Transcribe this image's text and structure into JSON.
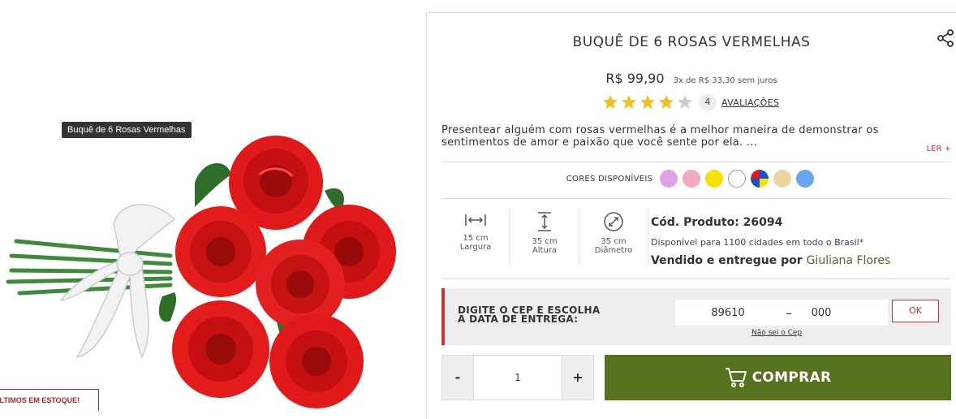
{
  "image": {
    "tooltip": "Buquê de 6 Rosas Vermelhas",
    "stock_badge": "ÚLTIMOS EM ESTOQUE!"
  },
  "product": {
    "title": "BUQUÊ DE 6 ROSAS VERMELHAS",
    "price": "R$ 99,90",
    "installments": "3x de R$ 33,30 sem juros",
    "rating": 4,
    "rating_max": 5,
    "review_count": "4",
    "reviews_label": "AVALIAÇÕES",
    "description": "Presentear alguém com rosas vermelhas é a melhor maneira de demonstrar os sentimentos de amor e paixão que você sente por ela. ...",
    "read_more": "LER +"
  },
  "colors": {
    "label": "CORES DISPONÍVEIS",
    "swatches": [
      "#e0a2e6",
      "#f4a9c0",
      "#f4e400",
      "#ffffff",
      "multicolor",
      "#ead5a0",
      "#6aa6f0"
    ]
  },
  "dimensions": [
    {
      "value": "15 cm",
      "label": "Largura",
      "icon": "width-icon"
    },
    {
      "value": "35 cm",
      "label": "Altura",
      "icon": "height-icon"
    },
    {
      "value": "35 cm",
      "label": "Diâmetro",
      "icon": "diameter-icon"
    }
  ],
  "info": {
    "code": "Cód. Produto: 26094",
    "availability": "Disponível para 1100 cidades em todo o Brasil*",
    "seller_prefix": "Vendido e entregue por",
    "seller_name": "Giuliana Flores"
  },
  "cep": {
    "label_line1": "DIGITE O CEP E ESCOLHA",
    "label_line2": "A DATA DE ENTREGA:",
    "part1": "89610",
    "dash": "–",
    "part2": "000",
    "ok_label": "OK",
    "dont_know": "Não sei o Cep"
  },
  "purchase": {
    "minus": "-",
    "quantity": "1",
    "plus": "+",
    "buy_label": "COMPRAR"
  },
  "theme": {
    "accent_red": "#cc3333",
    "buy_green": "#55731f",
    "star_gold": "#f0c020"
  }
}
